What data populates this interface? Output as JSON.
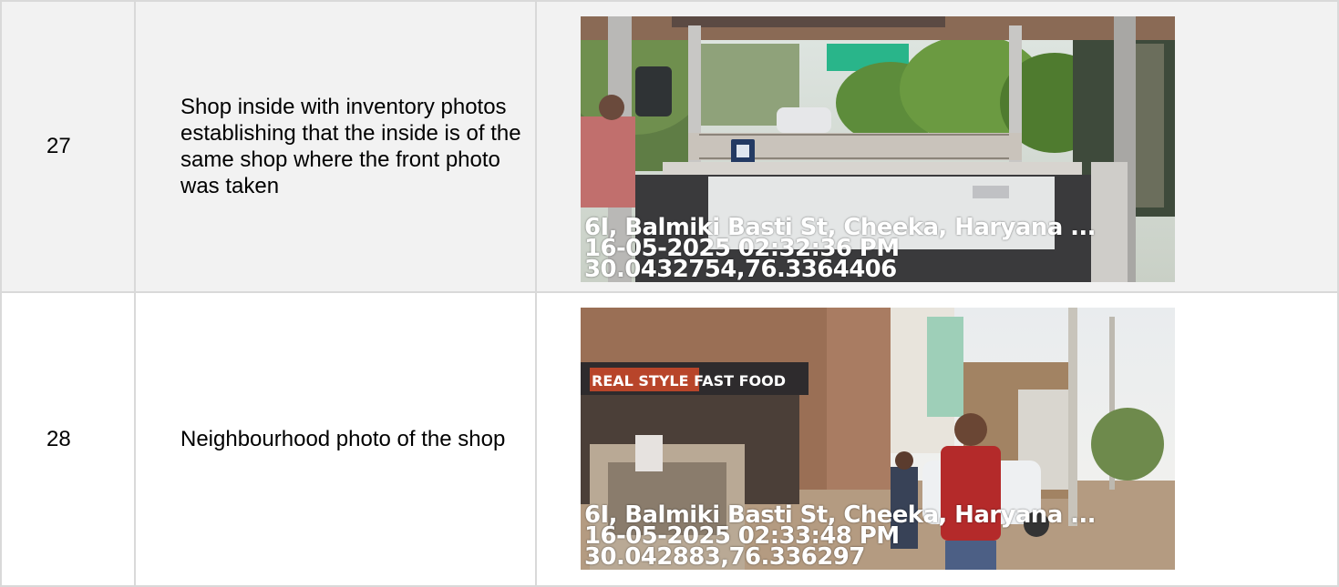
{
  "rows": [
    {
      "number": "27",
      "description": "Shop inside with inventory photos establishing that the inside is of the same shop where the front photo was taken",
      "photo": {
        "address": "6I, Balmiki Basti St, Cheeka, Haryana ...",
        "timestamp": "16-05-2025 02:32:36 PM",
        "coordinates": "30.0432754,76.3364406"
      }
    },
    {
      "number": "28",
      "description": "Neighbourhood photo of the shop",
      "photo": {
        "address": "6I, Balmiki Basti St, Cheeka, Haryana ...",
        "timestamp": "16-05-2025 02:33:48 PM",
        "coordinates": "30.042883,76.336297",
        "sign_text": "REAL STYLE FAST FOOD"
      }
    }
  ]
}
